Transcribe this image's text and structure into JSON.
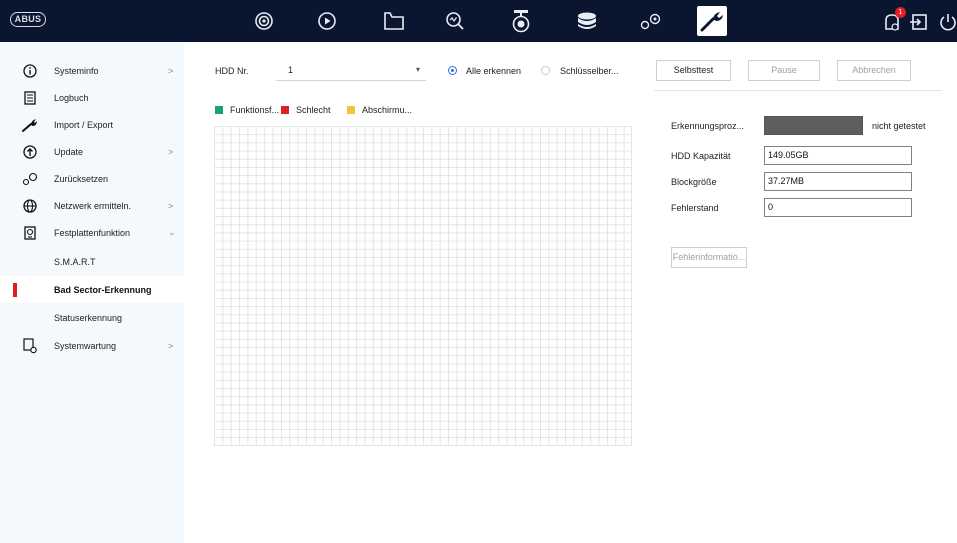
{
  "topbar": {
    "logo": "ABUS",
    "nav": [
      {
        "name": "live-view-icon"
      },
      {
        "name": "playback-icon"
      },
      {
        "name": "file-management-icon"
      },
      {
        "name": "smart-analysis-icon"
      },
      {
        "name": "camera-icon"
      },
      {
        "name": "storage-icon"
      },
      {
        "name": "system-settings-icon"
      },
      {
        "name": "maintenance-icon",
        "active": true
      }
    ],
    "notification_count": "1"
  },
  "sidebar": {
    "items": [
      {
        "label": "Systeminfo",
        "chevron": ">"
      },
      {
        "label": "Logbuch"
      },
      {
        "label": "Import / Export"
      },
      {
        "label": "Update",
        "chevron": ">"
      },
      {
        "label": "Zurücksetzen"
      },
      {
        "label": "Netzwerk ermitteln.",
        "chevron": ">"
      },
      {
        "label": "Festplattenfunktion",
        "chevron": "⌄"
      },
      {
        "label": "S.M.A.R.T"
      },
      {
        "label": "Bad Sector-Erkennung"
      },
      {
        "label": "Statuserkennung"
      },
      {
        "label": "Systemwartung",
        "chevron": ">"
      }
    ]
  },
  "controls": {
    "hdd_label": "HDD Nr.",
    "hdd_value": "1",
    "radio_all": "Alle erkennen",
    "radio_key": "Schlüsselber...",
    "btn_selftest": "Selbsttest",
    "btn_pause": "Pause",
    "btn_cancel": "Abbrechen"
  },
  "legend": {
    "good": "Funktionsf...",
    "bad": "Schlecht",
    "shield": "Abschirmu...",
    "colors": {
      "good": "#1aa37a",
      "bad": "#e02020",
      "shield": "#f5c23b"
    }
  },
  "details": {
    "progress_label": "Erkennungsproz...",
    "progress_status": "nicht getestet",
    "progress_value": 0,
    "capacity_label": "HDD Kapazität",
    "capacity_value": "149.05GB",
    "block_label": "Blockgröße",
    "block_value": "37.27MB",
    "error_label": "Fehlerstand",
    "error_value": "0",
    "error_info_button": "Fehlerinformatio..."
  }
}
